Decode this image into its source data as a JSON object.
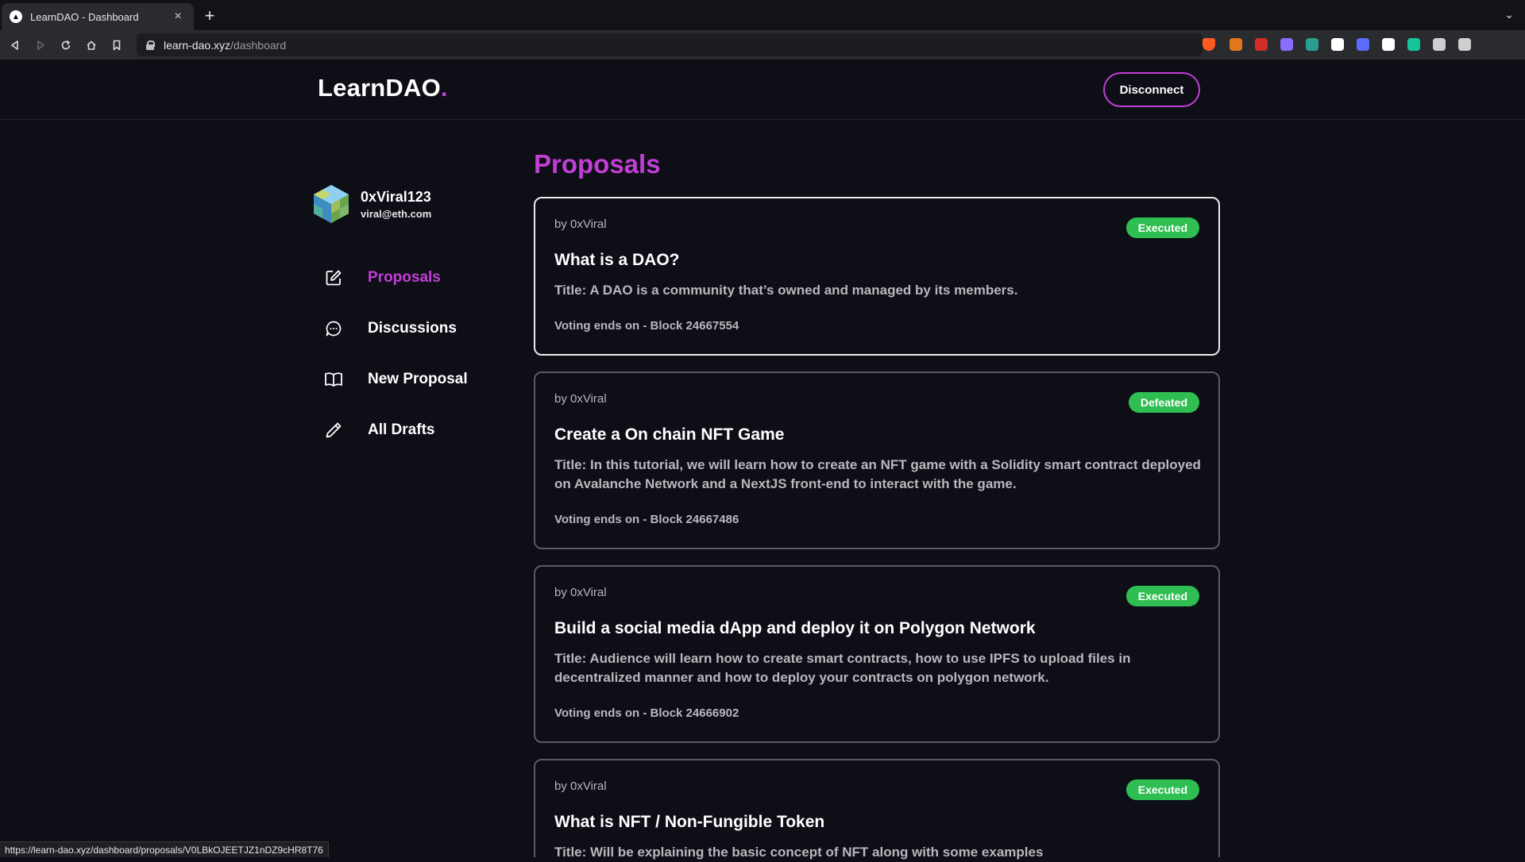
{
  "browser": {
    "tab_title": "LearnDAO - Dashboard",
    "tab_favicon": "▲",
    "url_host": "learn-dao.xyz",
    "url_path": "/dashboard",
    "status_url": "https://learn-dao.xyz/dashboard/proposals/V0LBkOJEETJZ1nDZ9cHR8T76",
    "extensions": [
      {
        "name": "brave-shield-icon",
        "color": "#ff5a1f"
      },
      {
        "name": "metamask-icon",
        "color": "#e2761b"
      },
      {
        "name": "lastpass-icon",
        "color": "#d32d27"
      },
      {
        "name": "extension-purple-icon",
        "color": "#8a6cff"
      },
      {
        "name": "extension-n-icon",
        "color": "#2a9d8f"
      },
      {
        "name": "extension-b-icon",
        "color": "#ffffff"
      },
      {
        "name": "extension-gear-icon",
        "color": "#5b6cff"
      },
      {
        "name": "notion-icon",
        "color": "#ffffff"
      },
      {
        "name": "grammarly-icon",
        "color": "#15c39a"
      },
      {
        "name": "puzzle-icon",
        "color": "#cfcfcf"
      },
      {
        "name": "wallet-icon",
        "color": "#cfcfcf"
      }
    ]
  },
  "header": {
    "logo": "LearnDAO",
    "logo_dot": ".",
    "disconnect_label": "Disconnect"
  },
  "profile": {
    "name": "0xViral123",
    "email": "viral@eth.com"
  },
  "sidebar": {
    "items": [
      {
        "label": "Proposals",
        "icon": "edit-icon",
        "active": true
      },
      {
        "label": "Discussions",
        "icon": "chat-icon",
        "active": false
      },
      {
        "label": "New Proposal",
        "icon": "book-icon",
        "active": false
      },
      {
        "label": "All Drafts",
        "icon": "pencil-icon",
        "active": false
      }
    ]
  },
  "main": {
    "title": "Proposals",
    "proposals": [
      {
        "author": "by 0xViral",
        "status": "Executed",
        "title": "What is a DAO?",
        "description": "Title: A DAO is a community that’s owned and managed by its members.",
        "voting": "Voting ends on - Block 24667554"
      },
      {
        "author": "by 0xViral",
        "status": "Defeated",
        "title": "Create a On chain NFT Game",
        "description": "Title: In this tutorial, we will learn how to create an NFT game with a Solidity smart contract deployed on Avalanche Network and a NextJS front-end to interact with the game.",
        "voting": "Voting ends on - Block 24667486"
      },
      {
        "author": "by 0xViral",
        "status": "Executed",
        "title": "Build a social media dApp and deploy it on Polygon Network",
        "description": "Title: Audience will learn how to create smart contracts, how to use IPFS to upload files in decentralized manner and how to deploy your contracts on polygon network.",
        "voting": "Voting ends on - Block 24666902"
      },
      {
        "author": "by 0xViral",
        "status": "Executed",
        "title": "What is NFT / Non-Fungible Token",
        "description": "Title: Will be explaining the basic concept of NFT along with some examples",
        "voting": ""
      }
    ]
  },
  "colors": {
    "accent": "#c23fd6",
    "badge_green": "#2fbe52",
    "background": "#0d0e16"
  }
}
